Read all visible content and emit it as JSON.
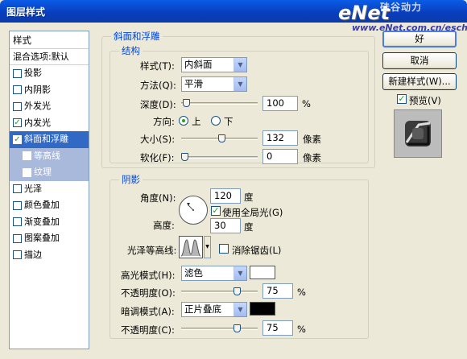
{
  "window": {
    "title": "图层样式"
  },
  "watermark": {
    "logo": "eNet",
    "chinese": "硅谷动力",
    "url": "www.eNet.com.cn/eschool"
  },
  "style_list": {
    "header": "样式",
    "blend": "混合选项:默认",
    "items": [
      {
        "label": "投影",
        "checked": false
      },
      {
        "label": "内阴影",
        "checked": false
      },
      {
        "label": "外发光",
        "checked": false
      },
      {
        "label": "内发光",
        "checked": true
      },
      {
        "label": "斜面和浮雕",
        "checked": true,
        "selected": true
      },
      {
        "label": "等高线",
        "checked": false,
        "sub": true
      },
      {
        "label": "纹理",
        "checked": false,
        "sub": true
      },
      {
        "label": "光泽",
        "checked": false
      },
      {
        "label": "颜色叠加",
        "checked": false
      },
      {
        "label": "渐变叠加",
        "checked": false
      },
      {
        "label": "图案叠加",
        "checked": false
      },
      {
        "label": "描边",
        "checked": false
      }
    ]
  },
  "bevel": {
    "section_title": "斜面和浮雕",
    "structure": {
      "title": "结构",
      "style_label": "样式(T):",
      "style_value": "内斜面",
      "technique_label": "方法(Q):",
      "technique_value": "平滑",
      "depth_label": "深度(D):",
      "depth_value": "100",
      "depth_unit": "%",
      "depth_fraction": 0.02,
      "direction_label": "方向:",
      "direction_up": "上",
      "direction_down": "下",
      "direction_selected": "上",
      "size_label": "大小(S):",
      "size_value": "132",
      "size_unit": "像素",
      "size_fraction": 0.53,
      "soften_label": "软化(F):",
      "soften_value": "0",
      "soften_unit": "像素",
      "soften_fraction": 0.0
    },
    "shading": {
      "title": "阴影",
      "angle_label": "角度(N):",
      "angle_value": "120",
      "angle_unit": "度",
      "global_light_label": "使用全局光(G)",
      "global_light_checked": true,
      "altitude_label": "高度:",
      "altitude_value": "30",
      "altitude_unit": "度",
      "gloss_label": "光泽等高线:",
      "antialias_label": "消除锯齿(L)",
      "antialias_checked": false,
      "highlight_label": "高光模式(H):",
      "highlight_mode": "滤色",
      "highlight_color": "#ffffff",
      "highlight_opacity_label": "不透明度(O):",
      "highlight_opacity": "75",
      "highlight_opacity_unit": "%",
      "highlight_opacity_fraction": 0.75,
      "shadow_label": "暗调模式(A):",
      "shadow_mode": "正片叠底",
      "shadow_color": "#000000",
      "shadow_opacity_label": "不透明度(C):",
      "shadow_opacity": "75",
      "shadow_opacity_unit": "%",
      "shadow_opacity_fraction": 0.75
    }
  },
  "buttons": {
    "ok": "好",
    "cancel": "取消",
    "new_style": "新建样式(W)...",
    "preview": "预览(V)",
    "preview_checked": true
  },
  "icons": {
    "check": "✓",
    "dropdown": "▼"
  }
}
